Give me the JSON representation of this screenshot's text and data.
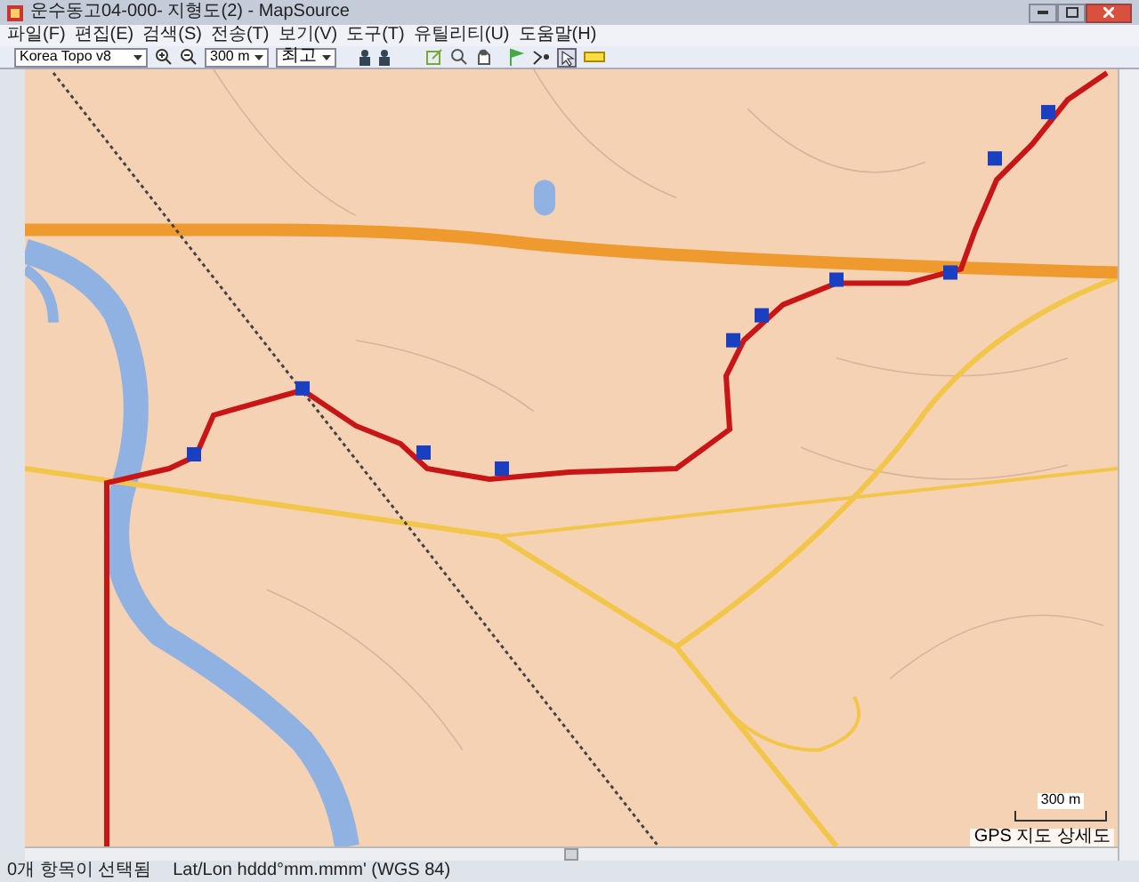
{
  "window": {
    "title": "운수동고04-000- 지형도(2) - MapSource"
  },
  "menu": [
    "파일(F)",
    "편집(E)",
    "검색(S)",
    "전송(T)",
    "보기(V)",
    "도구(T)",
    "유틸리티(U)",
    "도움말(H)"
  ],
  "toolbar": {
    "map_product": "Korea Topo v8",
    "zoom": "300 m",
    "detail": "최고"
  },
  "map": {
    "scale_label": "300 m",
    "detail_label": "GPS 지도 상세도"
  },
  "status_bar": [
    "0개 항목이 선택됨",
    "Lat/Lon hddd°mm.mmm' (WGS 84)"
  ]
}
